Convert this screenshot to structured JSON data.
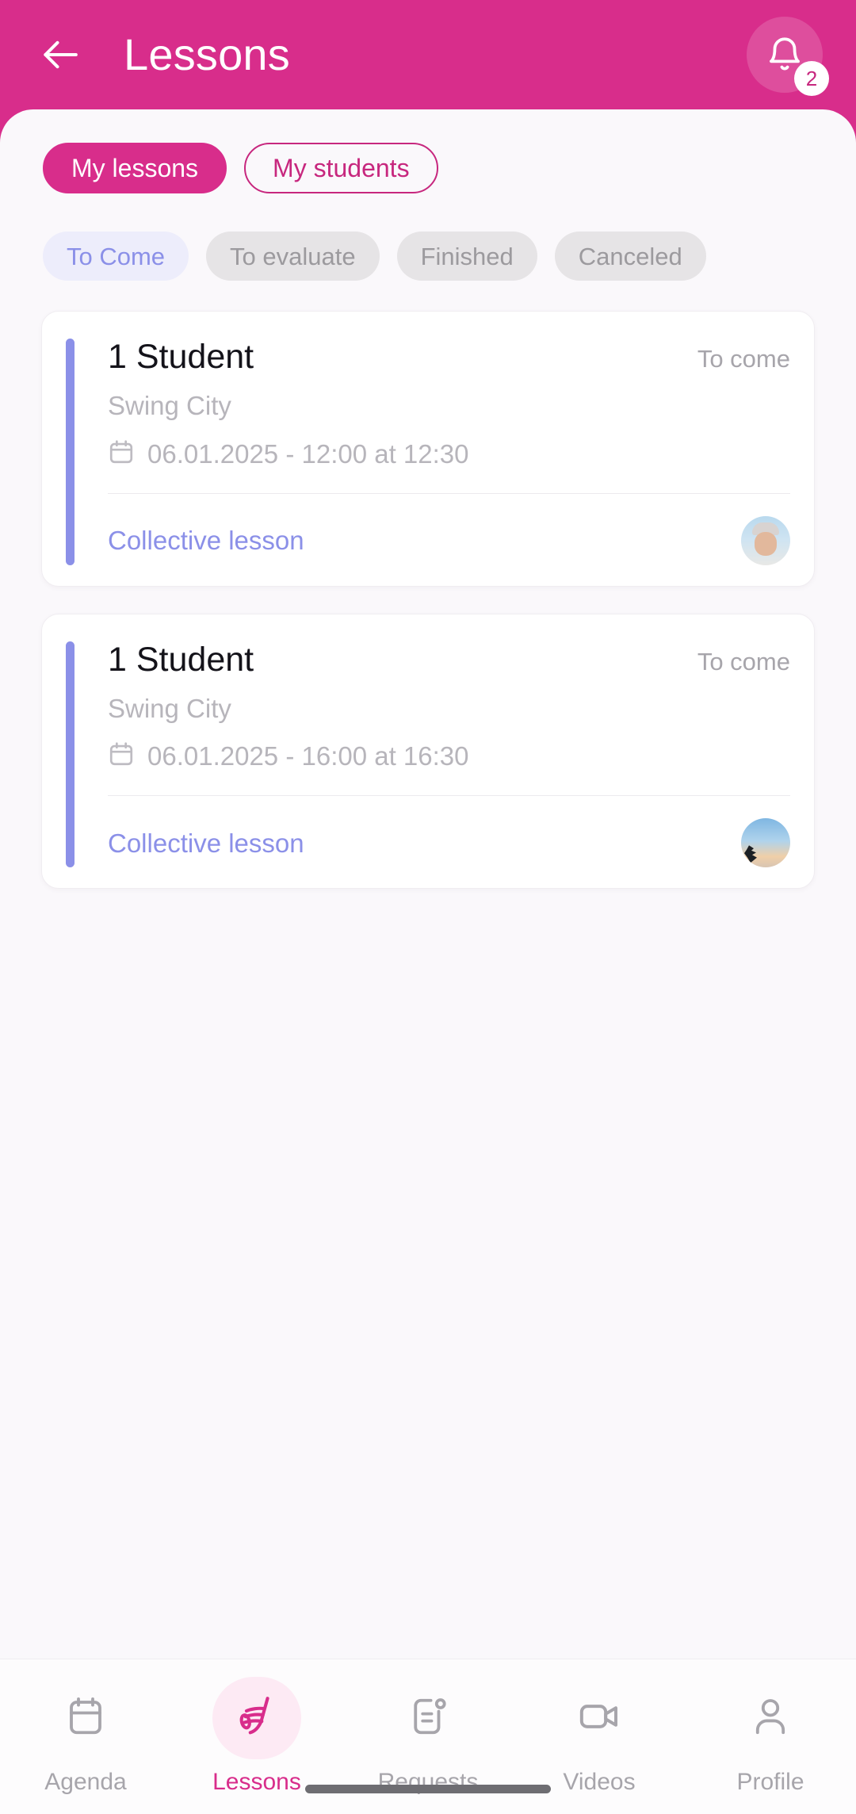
{
  "header": {
    "title": "Lessons",
    "back_icon": "arrow-left-icon",
    "notification_icon": "bell-icon",
    "notification_count": "2"
  },
  "segments": [
    {
      "label": "My lessons",
      "active": true
    },
    {
      "label": "My students",
      "active": false
    }
  ],
  "filters": [
    {
      "label": "To Come",
      "selected": true
    },
    {
      "label": "To evaluate",
      "selected": false
    },
    {
      "label": "Finished",
      "selected": false
    },
    {
      "label": "Canceled",
      "selected": false
    }
  ],
  "lessons": [
    {
      "title": "1 Student",
      "status": "To come",
      "place": "Swing City",
      "date": "06.01.2025 - 12:00 at 12:30",
      "date_icon": "calendar-icon",
      "type": "Collective lesson",
      "avatar": "avatar-person-cap"
    },
    {
      "title": "1 Student",
      "status": "To come",
      "place": "Swing City",
      "date": "06.01.2025 - 16:00 at 16:30",
      "date_icon": "calendar-icon",
      "type": "Collective lesson",
      "avatar": "avatar-sunset"
    }
  ],
  "bottom_nav": [
    {
      "label": "Agenda",
      "icon": "calendar-icon",
      "active": false
    },
    {
      "label": "Lessons",
      "icon": "dance-shoe-icon",
      "active": true
    },
    {
      "label": "Requests",
      "icon": "document-badge-icon",
      "active": false
    },
    {
      "label": "Videos",
      "icon": "video-camera-icon",
      "active": false
    },
    {
      "label": "Profile",
      "icon": "person-icon",
      "active": false
    }
  ],
  "colors": {
    "brand_pink": "#D82D8B",
    "accent_periwinkle": "#8B90E8",
    "chip_selected_bg": "#EDEDFB",
    "chip_unselected_bg": "#E6E4E6",
    "page_bg": "#FAF8FB"
  }
}
